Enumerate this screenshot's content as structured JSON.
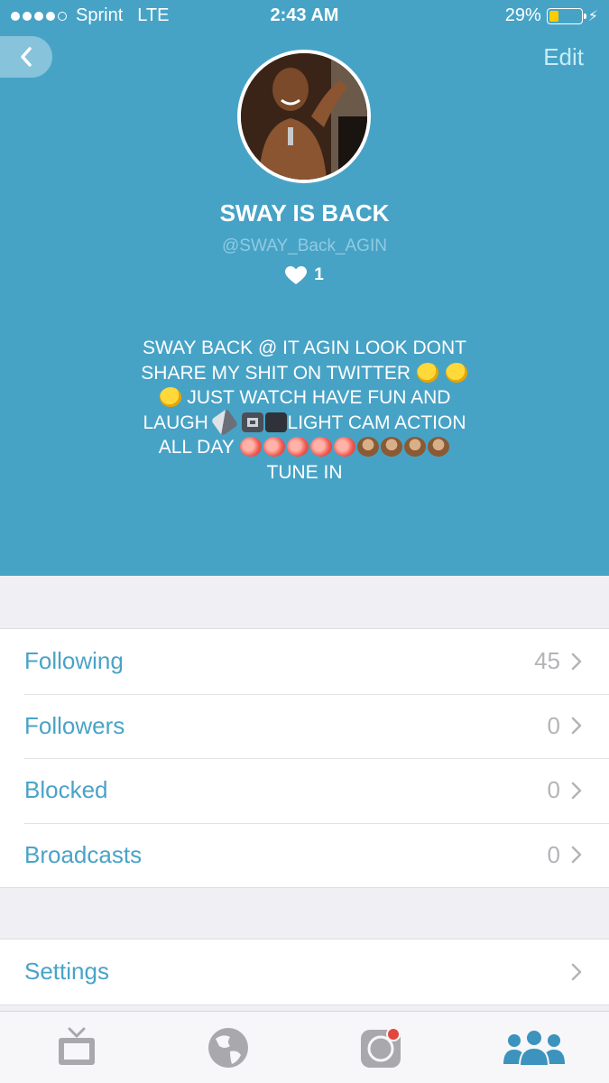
{
  "status_bar": {
    "carrier": "Sprint",
    "network": "LTE",
    "time": "2:43 AM",
    "battery_percent": "29%",
    "battery_level": 0.29
  },
  "nav": {
    "edit_label": "Edit"
  },
  "profile": {
    "name": "SWAY IS BACK",
    "handle": "@SWAY_Back_AGIN",
    "likes": "1"
  },
  "bio": {
    "line1": "SWAY BACK @ IT AGIN LOOK DONT",
    "line2": "SHARE MY SHIT ON TWITTER",
    "line3": "JUST WATCH HAVE FUN AND",
    "line4a": "LAUGH",
    "line4b": "LIGHT CAM ACTION",
    "line5": "ALL DAY",
    "line6": "TUNE IN"
  },
  "menu": {
    "following": {
      "label": "Following",
      "value": "45"
    },
    "followers": {
      "label": "Followers",
      "value": "0"
    },
    "blocked": {
      "label": "Blocked",
      "value": "0"
    },
    "broadcasts": {
      "label": "Broadcasts",
      "value": "0"
    },
    "settings": {
      "label": "Settings"
    }
  },
  "tabs": [
    "tv-icon",
    "globe-icon",
    "camera-icon",
    "people-icon"
  ],
  "colors": {
    "header_bg": "#47a3c6",
    "accent": "#4aa3c8",
    "battery": "#ffcc00"
  }
}
